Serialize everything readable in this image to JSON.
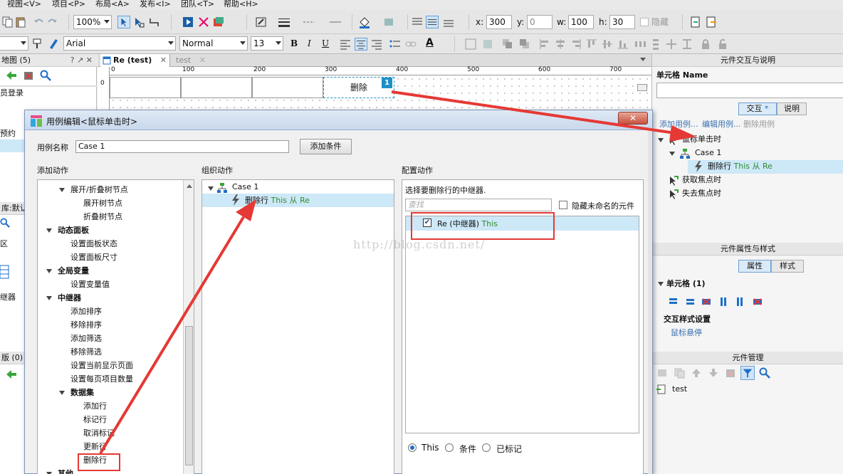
{
  "menu": [
    "视图<V>",
    "项目<P>",
    "布局<A>",
    "发布<I>",
    "团队<T>",
    "帮助<H>"
  ],
  "toolbar": {
    "zoom": "100%",
    "font": "Arial",
    "style": "Normal",
    "size": "13",
    "x_label": "x:",
    "x_value": "300",
    "y_label": "y:",
    "y_value": "0",
    "w_label": "w:",
    "w_value": "100",
    "h_label": "h:",
    "h_value": "30",
    "hidden_label": "隐藏"
  },
  "left_panel": {
    "sitemap_header": "地图 (5)",
    "sitemap_item": "员登录",
    "item2": "预约",
    "library_header": "库:默认",
    "area_item": "区",
    "repeater_item": "继器",
    "masters_header": "版 (0)"
  },
  "tabs": [
    {
      "label": "Re (test)"
    },
    {
      "label": "test"
    }
  ],
  "ruler": [
    "0",
    "100",
    "200",
    "300",
    "400",
    "500",
    "600",
    "700"
  ],
  "ruler_v": "0",
  "canvas": {
    "cell_label": "删除",
    "badge": "1"
  },
  "right_panel": {
    "interaction_header": "元件交互与说明",
    "cell_name_label": "单元格 Name",
    "tab_interact": "交互",
    "tab_interact_mark": "*",
    "tab_notes": "说明",
    "add_case": "添加用例...",
    "edit_case": "编辑用例...",
    "delete_case": "删除用例",
    "event_click": "鼠标单击时",
    "case1": "Case 1",
    "action_delete": "删除行",
    "action_target": "This 从 Re",
    "event_focus": "获取焦点时",
    "event_blur": "失去焦点时",
    "props_header": "元件属性与样式",
    "tab_props": "属性",
    "tab_style": "样式",
    "cell_section": "单元格 (1)",
    "interaction_style": "交互样式设置",
    "mouse_hover": "鼠标悬停",
    "manager_header": "元件管理",
    "manager_item": "test"
  },
  "dialog": {
    "title": "用例编辑<鼠标单击时>",
    "case_name_label": "用例名称",
    "case_name_value": "Case 1",
    "add_condition": "添加条件",
    "add_action_header": "添加动作",
    "organize_header": "组织动作",
    "config_header": "配置动作",
    "actions_tree": [
      {
        "label": "展开/折叠树节点",
        "level": 1,
        "bold": false,
        "expanded": true
      },
      {
        "label": "展开树节点",
        "level": 2,
        "bold": false
      },
      {
        "label": "折叠树节点",
        "level": 2,
        "bold": false
      },
      {
        "label": "动态面板",
        "level": 0,
        "bold": true,
        "expanded": true
      },
      {
        "label": "设置面板状态",
        "level": 1,
        "bold": false
      },
      {
        "label": "设置面板尺寸",
        "level": 1,
        "bold": false
      },
      {
        "label": "全局变量",
        "level": 0,
        "bold": true,
        "expanded": true
      },
      {
        "label": "设置变量值",
        "level": 1,
        "bold": false
      },
      {
        "label": "中继器",
        "level": 0,
        "bold": true,
        "expanded": true
      },
      {
        "label": "添加排序",
        "level": 1,
        "bold": false
      },
      {
        "label": "移除排序",
        "level": 1,
        "bold": false
      },
      {
        "label": "添加筛选",
        "level": 1,
        "bold": false
      },
      {
        "label": "移除筛选",
        "level": 1,
        "bold": false
      },
      {
        "label": "设置当前显示页面",
        "level": 1,
        "bold": false
      },
      {
        "label": "设置每页项目数量",
        "level": 1,
        "bold": false
      },
      {
        "label": "数据集",
        "level": 1,
        "bold": true,
        "expanded": true
      },
      {
        "label": "添加行",
        "level": 2,
        "bold": false
      },
      {
        "label": "标记行",
        "level": 2,
        "bold": false
      },
      {
        "label": "取消标记",
        "level": 2,
        "bold": false
      },
      {
        "label": "更新行",
        "level": 2,
        "bold": false
      },
      {
        "label": "删除行",
        "level": 2,
        "bold": false
      },
      {
        "label": "其他",
        "level": 0,
        "bold": true,
        "expanded": true
      }
    ],
    "org_case": "Case 1",
    "org_action": "删除行",
    "org_action_target": "This 从 Re",
    "config_prompt": "选择要删除行的中继器.",
    "search_placeholder": "查找",
    "hide_unnamed": "隐藏未命名的元件",
    "repeater_row_label": "Re (中继器)",
    "repeater_row_target": "This",
    "radio_this": "This",
    "radio_condition": "条件",
    "radio_marked": "已标记",
    "watermark": "http://blog.csdn.net/"
  },
  "colors": {
    "accent_red": "#e53935",
    "green_text": "#2e8b2e",
    "selection": "#cde8f7",
    "canvas_cell_border": "#1e90c8"
  }
}
